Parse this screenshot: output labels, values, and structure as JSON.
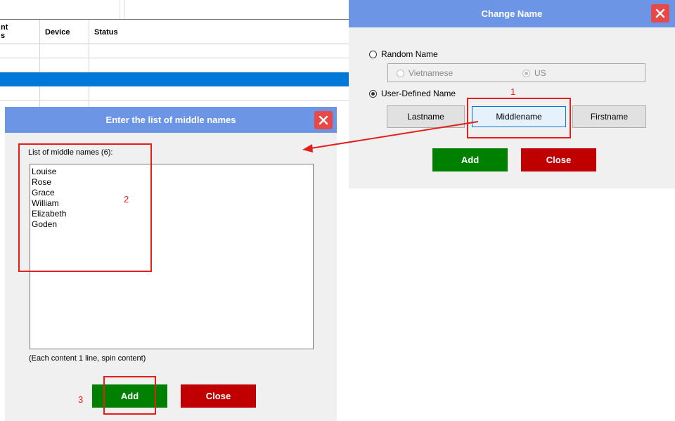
{
  "background_table": {
    "col_partial_top": "nt",
    "col_partial_bottom": "s",
    "col_device": "Device",
    "col_status": "Status"
  },
  "change_name_dialog": {
    "title": "Change Name",
    "random_name_label": "Random Name",
    "random_options": {
      "vietnamese": "Vietnamese",
      "us": "US"
    },
    "user_defined_label": "User-Defined Name",
    "segments": {
      "lastname": "Lastname",
      "middlename": "Middlename",
      "firstname": "Firstname"
    },
    "add_label": "Add",
    "close_label": "Close"
  },
  "middle_names_dialog": {
    "title": "Enter the list of middle names",
    "list_label": "List of middle names (6):",
    "names": [
      "Louise",
      "Rose",
      "Grace",
      "William",
      "Elizabeth",
      "Goden"
    ],
    "hint": "(Each content 1 line, spin content)",
    "add_label": "Add",
    "close_label": "Close"
  },
  "annotations": {
    "step1": "1",
    "step2": "2",
    "step3": "3"
  },
  "colors": {
    "title_bar": "#6d95e6",
    "close_button": "#e74848",
    "add_button": "#008000",
    "close_action": "#c00000",
    "annotation": "#e3201b",
    "selection": "#0078d7"
  }
}
